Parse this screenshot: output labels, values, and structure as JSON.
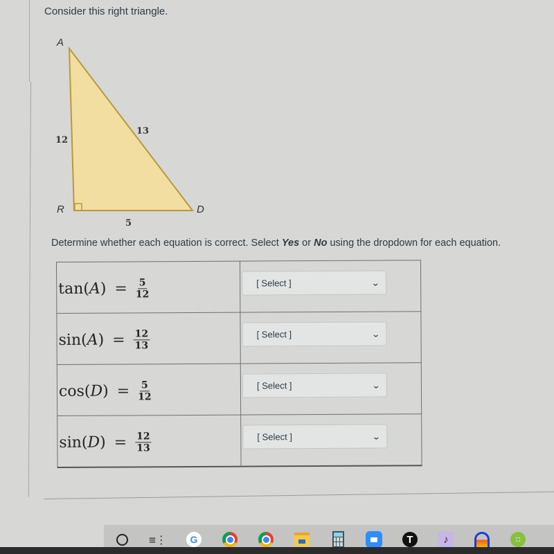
{
  "question": {
    "prompt": "Consider this right triangle.",
    "instruction_prefix": "Determine whether each equation is correct.  Select ",
    "instruction_yes": "Yes",
    "instruction_or": " or ",
    "instruction_no": "No",
    "instruction_suffix": " using the dropdown for each equation."
  },
  "triangle": {
    "vertices": {
      "top": "A",
      "right_angle": "R",
      "right": "D"
    },
    "sides": {
      "AR": "12",
      "AD": "13",
      "RD": "5"
    },
    "fill_color": "#f2dea0",
    "stroke_color": "#b89a3a"
  },
  "equations": [
    {
      "func": "tan",
      "arg": "A",
      "eq": "=",
      "numerator": "5",
      "denominator": "12",
      "select_label": "[ Select ]"
    },
    {
      "func": "sin",
      "arg": "A",
      "eq": "=",
      "numerator": "12",
      "denominator": "13",
      "select_label": "[ Select ]"
    },
    {
      "func": "cos",
      "arg": "D",
      "eq": "=",
      "numerator": "5",
      "denominator": "12",
      "select_label": "[ Select ]"
    },
    {
      "func": "sin",
      "arg": "D",
      "eq": "=",
      "numerator": "12",
      "denominator": "13",
      "select_label": "[ Select ]"
    }
  ],
  "taskbar": {
    "items": [
      {
        "name": "cortana-search",
        "icon": "circle-icon",
        "active": false
      },
      {
        "name": "task-view",
        "icon": "task-view-icon",
        "active": false
      },
      {
        "name": "google",
        "icon": "google-icon",
        "active": false
      },
      {
        "name": "chrome-profile-1",
        "icon": "chrome-icon",
        "active": true
      },
      {
        "name": "chrome-profile-2",
        "icon": "chrome-icon",
        "active": true
      },
      {
        "name": "file-explorer",
        "icon": "folder-icon",
        "active": false
      },
      {
        "name": "calculator",
        "icon": "calculator-icon",
        "active": false
      },
      {
        "name": "zoom",
        "icon": "video-camera-icon",
        "active": true
      },
      {
        "name": "app-t",
        "icon": "t-logo-icon",
        "active": false
      },
      {
        "name": "music-app",
        "icon": "music-note-icon",
        "active": false
      },
      {
        "name": "audacity",
        "icon": "headphones-icon",
        "active": false
      },
      {
        "name": "cloud-app",
        "icon": "cloud-icon",
        "active": false
      }
    ]
  }
}
